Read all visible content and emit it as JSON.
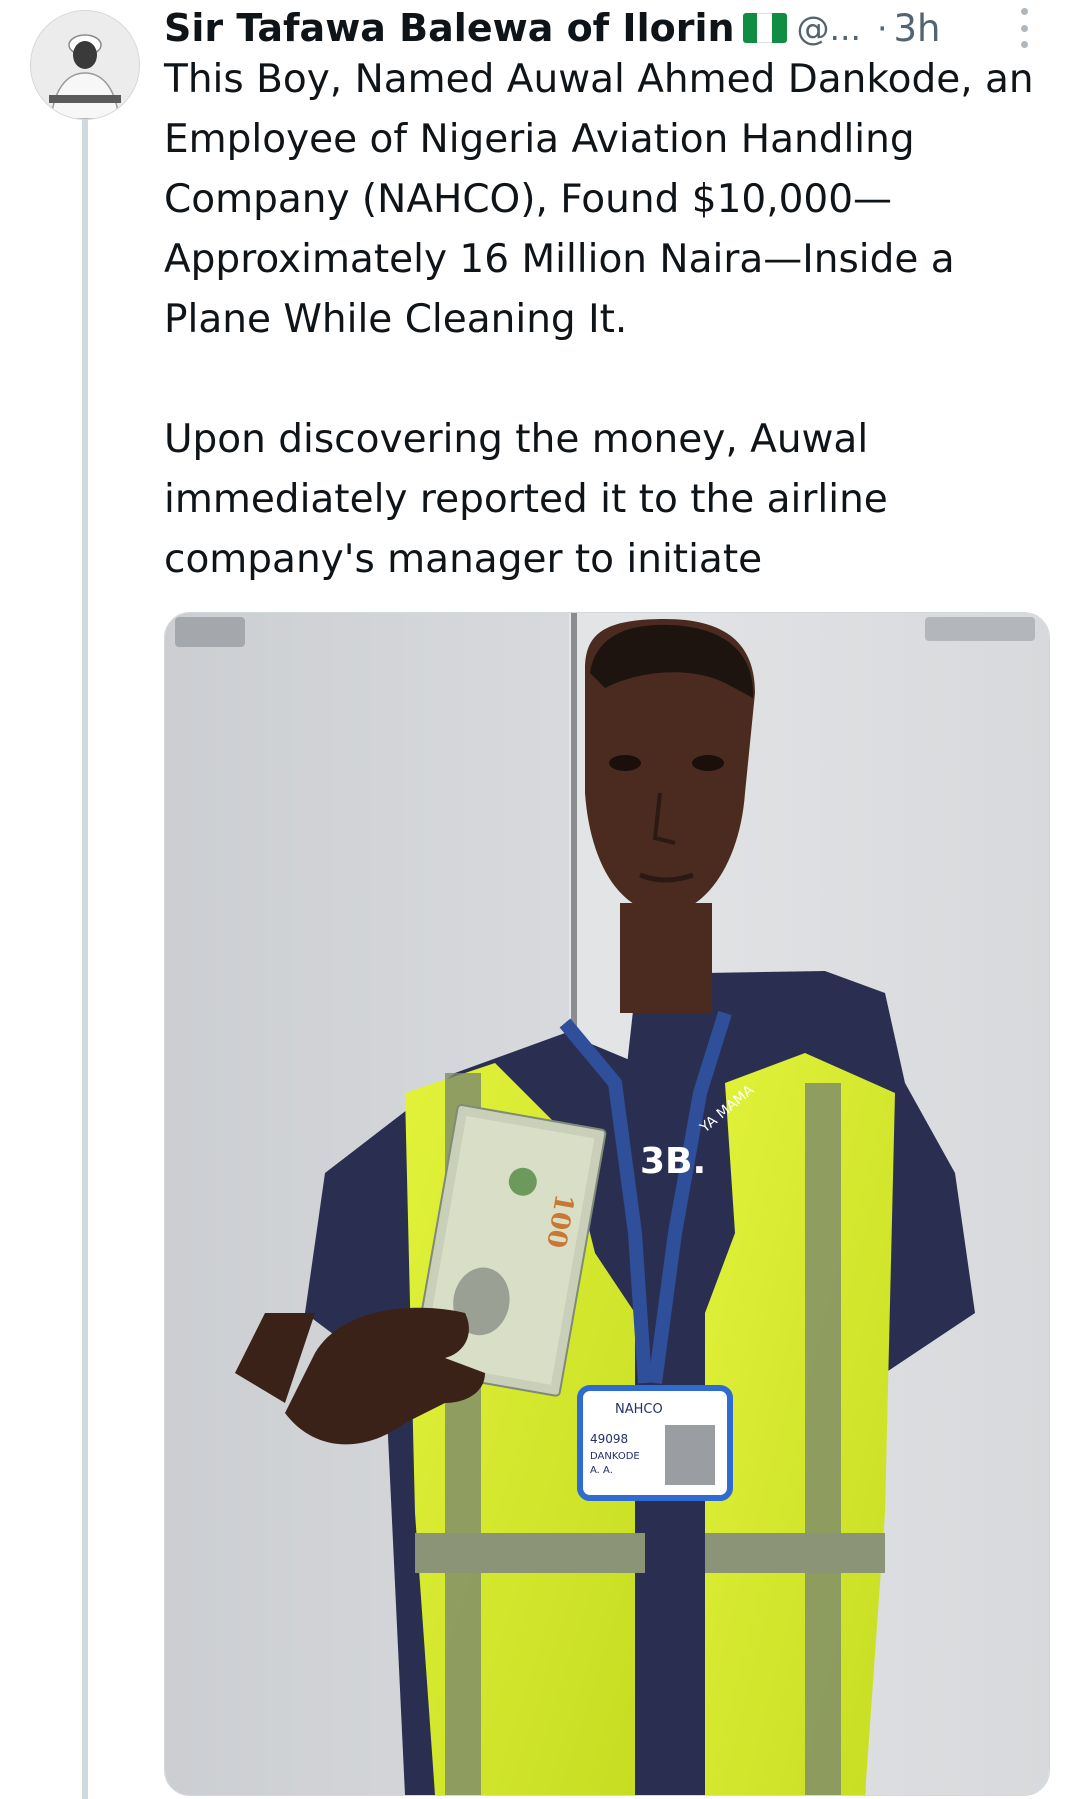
{
  "tweet": {
    "display_name": "Sir Tafawa Balewa of Ilorin",
    "handle": "@...",
    "separator": "·",
    "time": "3h",
    "flag_icon": "nigeria-flag-icon",
    "paragraphs": [
      "This Boy, Named Auwal Ahmed Dankode, an Employee of Nigeria Aviation Handling Company (NAHCO), Found $10,000—Approximately 16 Million Naira—Inside a Plane While Cleaning It.",
      "Upon discovering the money, Auwal immediately reported it to the airline company's manager to initiate"
    ],
    "media": {
      "badge_lines": [
        "NAHCO",
        "49098",
        "DANKODE",
        "A. A."
      ],
      "lanyard_text": "YA MAMA",
      "note_denomination": "100",
      "shirt_text": "3B."
    }
  },
  "colors": {
    "text_primary": "#0f1419",
    "text_secondary": "#536471",
    "thread_line": "#cfd9de",
    "vest": "#d8ee2c",
    "shirt": "#2a2f52"
  }
}
